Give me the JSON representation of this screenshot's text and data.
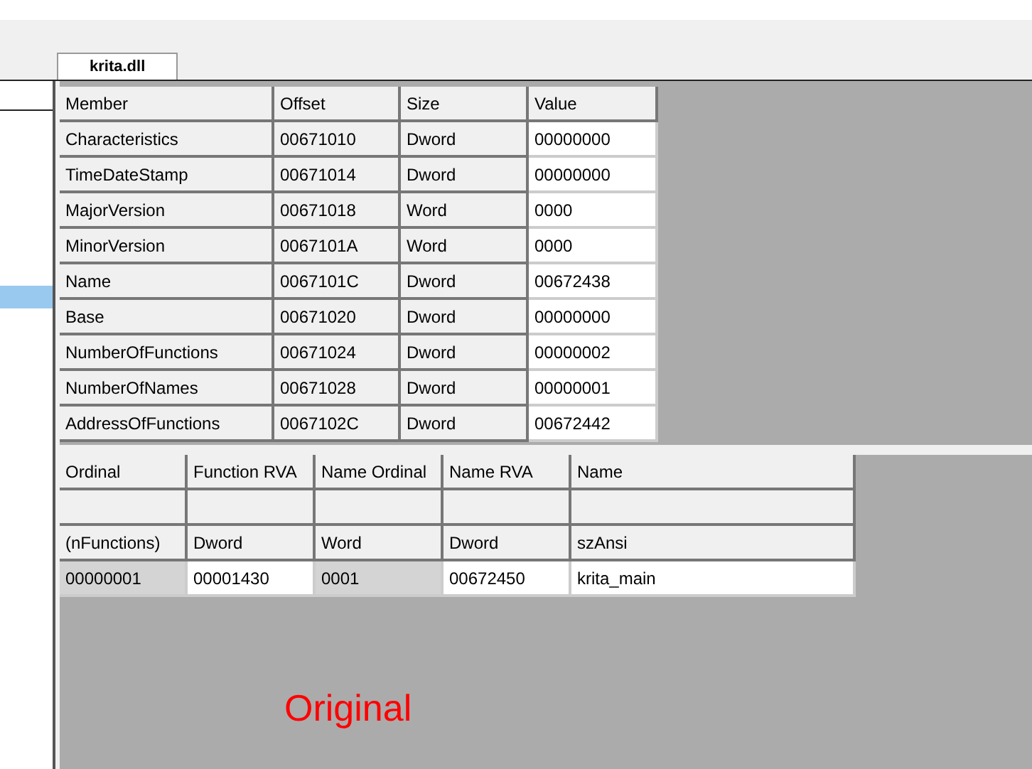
{
  "tabs": [
    {
      "label": "krita.dll",
      "selected": true
    }
  ],
  "members_table": {
    "columns": [
      "Member",
      "Offset",
      "Size",
      "Value"
    ],
    "rows": [
      [
        "Characteristics",
        "00671010",
        "Dword",
        "00000000"
      ],
      [
        "TimeDateStamp",
        "00671014",
        "Dword",
        "00000000"
      ],
      [
        "MajorVersion",
        "00671018",
        "Word",
        "0000"
      ],
      [
        "MinorVersion",
        "0067101A",
        "Word",
        "0000"
      ],
      [
        "Name",
        "0067101C",
        "Dword",
        "00672438"
      ],
      [
        "Base",
        "00671020",
        "Dword",
        "00000000"
      ],
      [
        "NumberOfFunctions",
        "00671024",
        "Dword",
        "00000002"
      ],
      [
        "NumberOfNames",
        "00671028",
        "Dword",
        "00000001"
      ],
      [
        "AddressOfFunctions",
        "0067102C",
        "Dword",
        "00672442"
      ]
    ]
  },
  "exports_table": {
    "columns": [
      "Ordinal",
      "Function RVA",
      "Name Ordinal",
      "Name RVA",
      "Name"
    ],
    "types": [
      "(nFunctions)",
      "Dword",
      "Word",
      "Dword",
      "szAnsi"
    ],
    "rows": [
      [
        {
          "text": "00000001",
          "shaded": true
        },
        {
          "text": "00001430",
          "shaded": false
        },
        {
          "text": "0001",
          "shaded": true
        },
        {
          "text": "00672450",
          "shaded": false
        },
        {
          "text": "krita_main",
          "shaded": false
        }
      ]
    ]
  },
  "caption": "Original"
}
